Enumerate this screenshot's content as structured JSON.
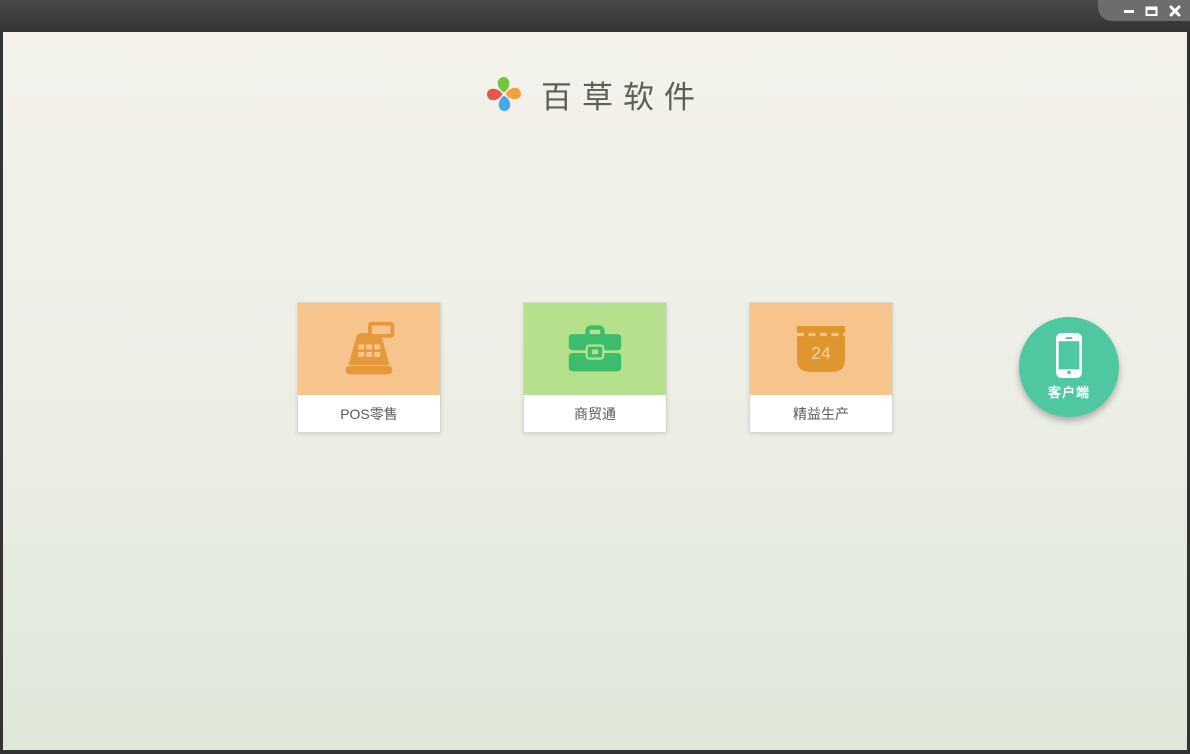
{
  "window": {
    "controls": [
      {
        "name": "minimize"
      },
      {
        "name": "maximize"
      },
      {
        "name": "close"
      }
    ]
  },
  "header": {
    "app_title": "百草软件",
    "logo": "pinwheel-logo"
  },
  "products": [
    {
      "label": "POS零售",
      "icon": "cash-register-icon",
      "tile_color": "#f6c48c",
      "icon_color": "#e5993a"
    },
    {
      "label": "商贸通",
      "icon": "briefcase-icon",
      "tile_color": "#b5e18c",
      "icon_color": "#3bbd6d"
    },
    {
      "label": "精益生产",
      "icon": "calendar-icon",
      "tile_color": "#f6c48c",
      "icon_color": "#e0962e",
      "calendar_day": "24"
    }
  ],
  "client_button": {
    "label": "客户端",
    "icon": "smartphone-icon",
    "color": "#4fc7a0"
  },
  "colors": {
    "titlebar_top": "#4a4a4a",
    "titlebar_bottom": "#333333",
    "bg_top": "#f3f1ea",
    "bg_bottom": "#dfe7d9",
    "logo_green": "#76c33f",
    "logo_orange": "#f2a13c",
    "logo_blue": "#49a8ea",
    "logo_red": "#e4574a"
  }
}
